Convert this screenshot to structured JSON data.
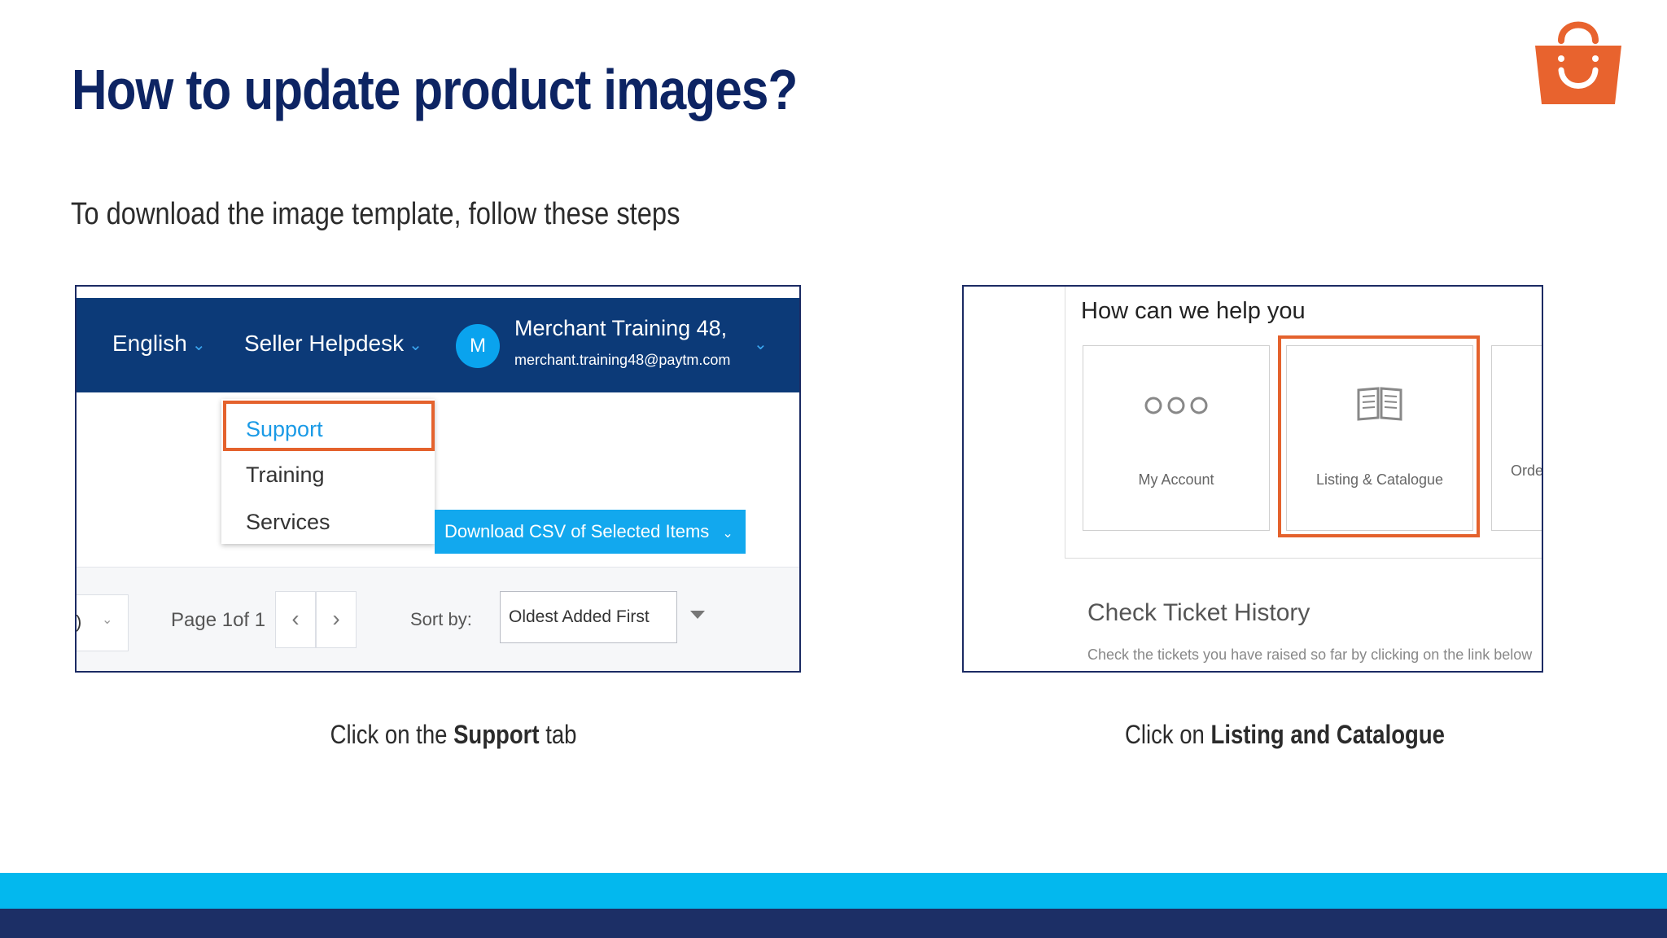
{
  "slide": {
    "title": "How to update product images?",
    "subtitle": "To download the image template, follow these steps",
    "colors": {
      "title": "#0d2463",
      "accent": "#03b8ee",
      "dark": "#1c2f66",
      "highlight": "#e4622d"
    },
    "logo_icon": "shopping-bag-icon"
  },
  "left_shot": {
    "nav": {
      "language": "English",
      "helpdesk": "Seller Helpdesk",
      "avatar_letter": "M",
      "user_name": "Merchant Training 48,",
      "user_email": "merchant.training48@paytm.com"
    },
    "dropdown": [
      "Support",
      "Training",
      "Services"
    ],
    "csv_button": "Download CSV of Selected Items",
    "pager": {
      "page_label": "Page 1of 1",
      "partial": ")"
    },
    "sort": {
      "label": "Sort by:",
      "value": "Oldest Added First"
    }
  },
  "right_shot": {
    "heading": "How can we help you",
    "cards": [
      "My Account",
      "Listing & Catalogue",
      "Orde"
    ],
    "history_title": "Check Ticket History",
    "history_text": "Check the tickets you have raised so far by clicking on the link below"
  },
  "captions": {
    "left_prefix": "Click on the ",
    "left_bold": "Support",
    "left_suffix": " tab",
    "right_prefix": "Click on ",
    "right_bold": "Listing and Catalogue"
  }
}
